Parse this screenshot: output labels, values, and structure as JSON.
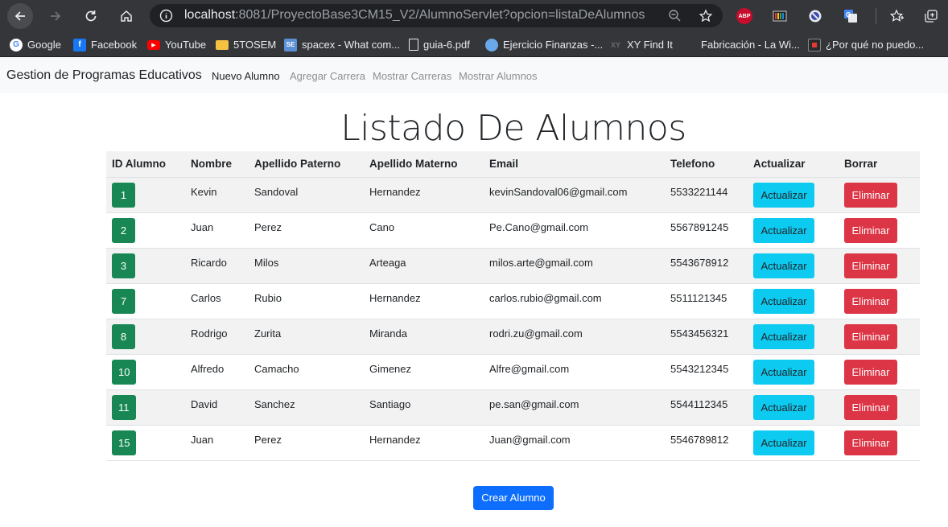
{
  "browser": {
    "url_host": "localhost",
    "url_rest": ":8081/ProyectoBase3CM15_V2/AlumnoServlet?opcion=listaDeAlumnos",
    "extension_abp": "ABP"
  },
  "bookmarks": [
    {
      "label": "Google",
      "icon": "google-icon"
    },
    {
      "label": "Facebook",
      "icon": "facebook-icon"
    },
    {
      "label": "YouTube",
      "icon": "youtube-icon"
    },
    {
      "label": "5TOSEM",
      "icon": "folder-icon"
    },
    {
      "label": "spacex - What com...",
      "icon": "stackexchange-icon"
    },
    {
      "label": "guia-6.pdf",
      "icon": "file-icon"
    },
    {
      "label": "Ejercicio Finanzas -...",
      "icon": "globe-icon"
    },
    {
      "label": "XY Find It",
      "icon": "xy-icon"
    },
    {
      "label": "Fabricación - La Wi...",
      "icon": "wiki-icon"
    },
    {
      "label": "¿Por qué no puedo...",
      "icon": "red-square-icon"
    }
  ],
  "navbar": {
    "brand": "Gestion de Programas Educativos",
    "links": [
      "Nuevo Alumno",
      "Agregar Carrera",
      "Mostrar Carreras",
      "Mostrar Alumnos"
    ]
  },
  "main": {
    "title": "Listado De Alumnos",
    "headers": [
      "ID Alumno",
      "Nombre",
      "Apellido Paterno",
      "Apellido Materno",
      "Email",
      "Telefono",
      "Actualizar",
      "Borrar"
    ],
    "rows": [
      {
        "id": "1",
        "nombre": "Kevin",
        "paterno": "Sandoval",
        "materno": "Hernandez",
        "email": "kevinSandoval06@gmail.com",
        "telefono": "5533221144"
      },
      {
        "id": "2",
        "nombre": "Juan",
        "paterno": "Perez",
        "materno": "Cano",
        "email": "Pe.Cano@gmail.com",
        "telefono": "5567891245"
      },
      {
        "id": "3",
        "nombre": "Ricardo",
        "paterno": "Milos",
        "materno": "Arteaga",
        "email": "milos.arte@gmail.com",
        "telefono": "5543678912"
      },
      {
        "id": "7",
        "nombre": "Carlos",
        "paterno": "Rubio",
        "materno": "Hernandez",
        "email": "carlos.rubio@gmail.com",
        "telefono": "5511121345"
      },
      {
        "id": "8",
        "nombre": "Rodrigo",
        "paterno": "Zurita",
        "materno": "Miranda",
        "email": "rodri.zu@gmail.com",
        "telefono": "5543456321"
      },
      {
        "id": "10",
        "nombre": "Alfredo",
        "paterno": "Camacho",
        "materno": "Gimenez",
        "email": "Alfre@gmail.com",
        "telefono": "5543212345"
      },
      {
        "id": "11",
        "nombre": "David",
        "paterno": "Sanchez",
        "materno": "Santiago",
        "email": "pe.san@gmail.com",
        "telefono": "5544112345"
      },
      {
        "id": "15",
        "nombre": "Juan",
        "paterno": "Perez",
        "materno": "Hernandez",
        "email": "Juan@gmail.com",
        "telefono": "5546789812"
      }
    ],
    "update_label": "Actualizar",
    "delete_label": "Eliminar",
    "create_label": "Crear Alumno"
  },
  "colors": {
    "badge": "#198754",
    "update": "#0dcaf0",
    "delete": "#dc3545",
    "primary": "#0d6efd"
  }
}
